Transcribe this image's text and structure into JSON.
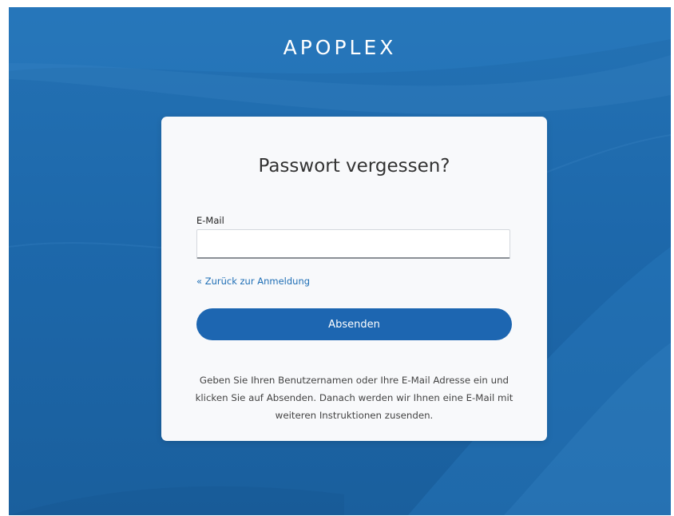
{
  "brand": {
    "title": "APOPLEX"
  },
  "card": {
    "title": "Passwort vergessen?",
    "email_label": "E-Mail",
    "email_value": "",
    "email_placeholder": "",
    "back_link": "« Zurück zur Anmeldung",
    "submit_label": "Absenden",
    "help_text": "Geben Sie Ihren Benutzernamen oder Ihre E-Mail Adresse ein und klicken Sie auf Absenden. Danach werden wir Ihnen eine E-Mail mit weiteren Instruktionen zusenden."
  },
  "colors": {
    "background": "#1d68ab",
    "accent": "#1d66b1",
    "link": "#1e6eb5",
    "card": "#f8f9fb"
  }
}
